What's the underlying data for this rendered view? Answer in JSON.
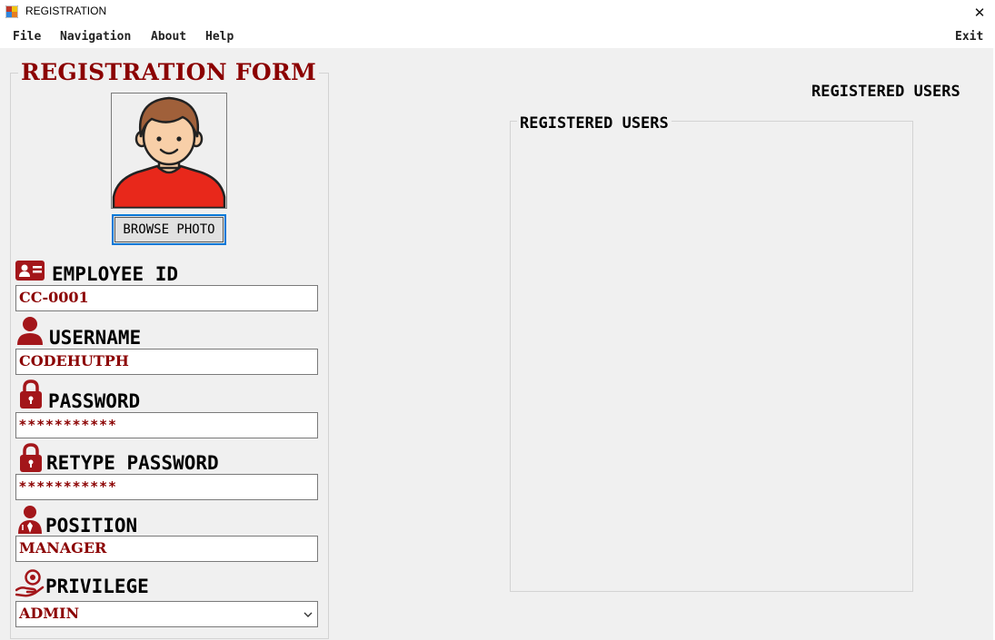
{
  "window": {
    "title": "REGISTRATION",
    "close_glyph": "✕"
  },
  "menu": {
    "file": "File",
    "navigation": "Navigation",
    "about": "About",
    "help": "Help",
    "exit": "Exit"
  },
  "form": {
    "title": "REGISTRATION FORM",
    "browse_label": "BROWSE PHOTO",
    "employee_id": {
      "label": "EMPLOYEE ID",
      "value": "CC-0001"
    },
    "username": {
      "label": "USERNAME",
      "value": "CODEHUTPH"
    },
    "password": {
      "label": "PASSWORD",
      "value": "***********"
    },
    "retype_password": {
      "label": "RETYPE PASSWORD",
      "value": "***********"
    },
    "position": {
      "label": "POSITION",
      "value": "MANAGER"
    },
    "privilege": {
      "label": "PRIVILEGE",
      "value": "ADMIN"
    }
  },
  "users": {
    "heading": "REGISTERED USERS",
    "group_title": "REGISTERED USERS"
  },
  "colors": {
    "accent": "#8b0000",
    "focus_border": "#0078d7",
    "background": "#f0f0f0"
  },
  "icons": [
    "app-icon",
    "close-icon",
    "avatar",
    "id-card-icon",
    "user-icon",
    "lock-icon",
    "manager-icon",
    "privilege-icon",
    "chevron-down-icon"
  ]
}
